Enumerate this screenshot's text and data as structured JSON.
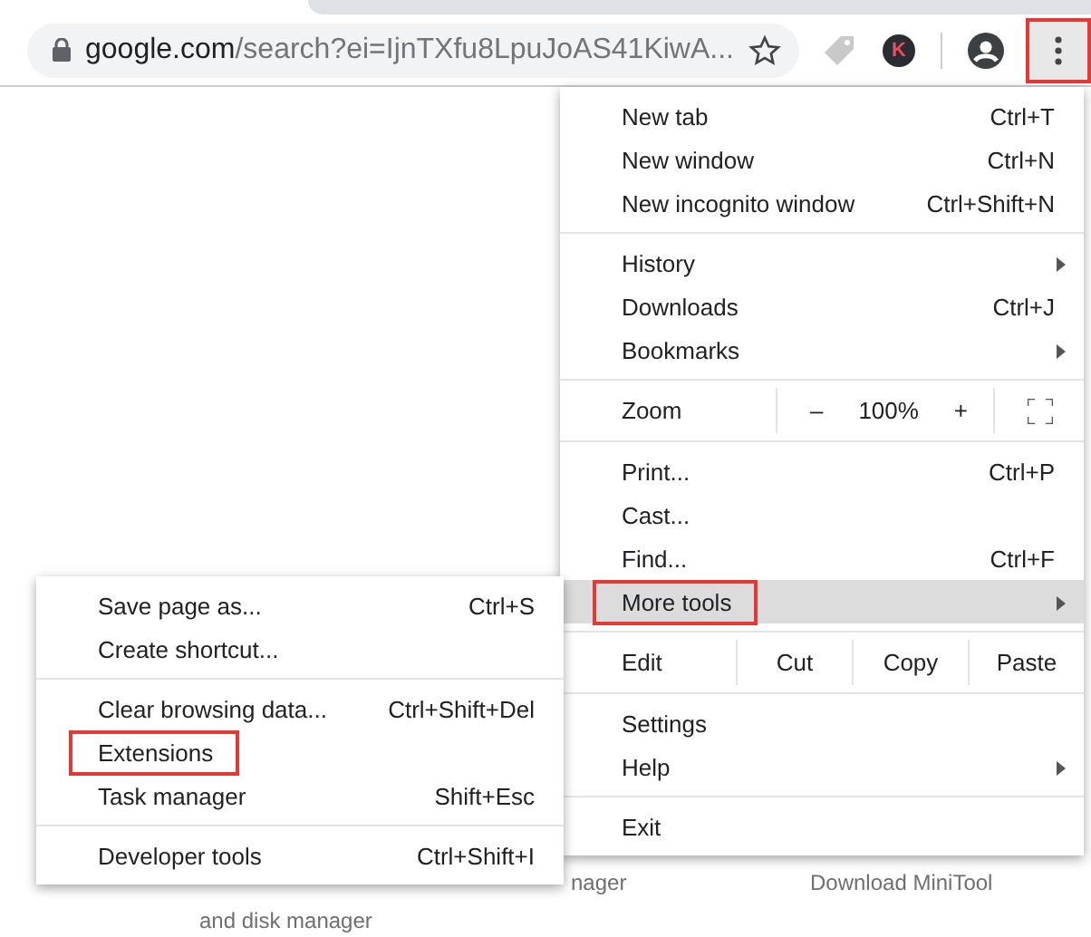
{
  "address_bar": {
    "host": "google.com",
    "path": "/search?ei=IjnTXfu8LpuJoAS41KiwA..."
  },
  "toolbar": {
    "avatar_letter": "K",
    "menu_button": {
      "highlighted": true
    }
  },
  "page_texts": [
    {
      "text": "nager"
    },
    {
      "text": "Download MiniTool"
    },
    {
      "text": "and disk manager"
    }
  ],
  "main_menu": {
    "sections": [
      [
        {
          "kind": "item",
          "label": "New tab",
          "shortcut": "Ctrl+T"
        },
        {
          "kind": "item",
          "label": "New window",
          "shortcut": "Ctrl+N"
        },
        {
          "kind": "item",
          "label": "New incognito window",
          "shortcut": "Ctrl+Shift+N"
        }
      ],
      [
        {
          "kind": "item",
          "label": "History",
          "submenu": true
        },
        {
          "kind": "item",
          "label": "Downloads",
          "shortcut": "Ctrl+J"
        },
        {
          "kind": "item",
          "label": "Bookmarks",
          "submenu": true
        }
      ],
      [
        {
          "kind": "zoom",
          "label": "Zoom",
          "minus": "–",
          "value": "100%",
          "plus": "+"
        }
      ],
      [
        {
          "kind": "item",
          "label": "Print...",
          "shortcut": "Ctrl+P"
        },
        {
          "kind": "item",
          "label": "Cast..."
        },
        {
          "kind": "item",
          "label": "Find...",
          "shortcut": "Ctrl+F"
        },
        {
          "kind": "item",
          "label": "More tools",
          "submenu": true,
          "hovered": true,
          "highlighted": true
        }
      ],
      [
        {
          "kind": "edit",
          "label": "Edit",
          "buttons": [
            "Cut",
            "Copy",
            "Paste"
          ]
        }
      ],
      [
        {
          "kind": "item",
          "label": "Settings"
        },
        {
          "kind": "item",
          "label": "Help",
          "submenu": true
        }
      ],
      [
        {
          "kind": "item",
          "label": "Exit"
        }
      ]
    ]
  },
  "submenu": {
    "sections": [
      [
        {
          "kind": "item",
          "label": "Save page as...",
          "shortcut": "Ctrl+S"
        },
        {
          "kind": "item",
          "label": "Create shortcut..."
        }
      ],
      [
        {
          "kind": "item",
          "label": "Clear browsing data...",
          "shortcut": "Ctrl+Shift+Del"
        },
        {
          "kind": "item",
          "label": "Extensions",
          "highlighted": true
        },
        {
          "kind": "item",
          "label": "Task manager",
          "shortcut": "Shift+Esc"
        }
      ],
      [
        {
          "kind": "item",
          "label": "Developer tools",
          "shortcut": "Ctrl+Shift+I"
        }
      ]
    ]
  }
}
